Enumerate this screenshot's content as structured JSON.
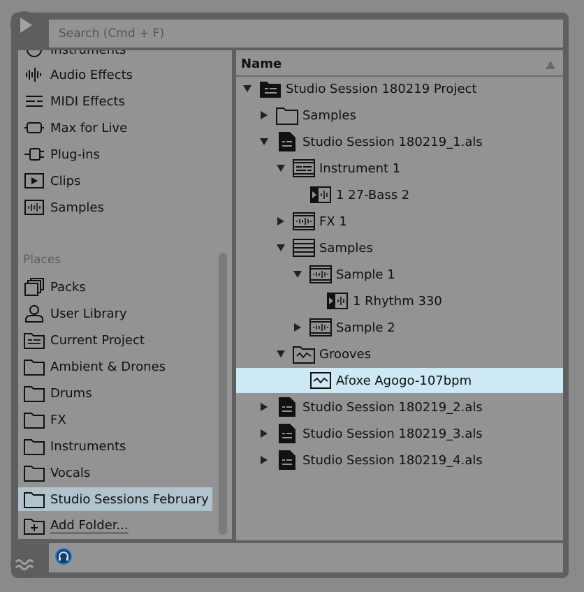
{
  "search": {
    "placeholder": "Search (Cmd + F)"
  },
  "sidebar": {
    "categories": [
      {
        "label": "Instruments",
        "icon": "instruments-icon"
      },
      {
        "label": "Audio Effects",
        "icon": "audio-effects-icon"
      },
      {
        "label": "MIDI Effects",
        "icon": "midi-effects-icon"
      },
      {
        "label": "Max for Live",
        "icon": "max-for-live-icon"
      },
      {
        "label": "Plug-ins",
        "icon": "plug-ins-icon"
      },
      {
        "label": "Clips",
        "icon": "clips-icon"
      },
      {
        "label": "Samples",
        "icon": "samples-icon"
      }
    ],
    "places_title": "Places",
    "places": [
      {
        "label": "Packs",
        "icon": "packs-icon"
      },
      {
        "label": "User Library",
        "icon": "user-icon"
      },
      {
        "label": "Current Project",
        "icon": "project-folder-icon"
      },
      {
        "label": "Ambient & Drones",
        "icon": "folder-icon"
      },
      {
        "label": "Drums",
        "icon": "folder-icon"
      },
      {
        "label": "FX",
        "icon": "folder-icon"
      },
      {
        "label": "Instruments",
        "icon": "folder-icon"
      },
      {
        "label": "Vocals",
        "icon": "folder-icon"
      },
      {
        "label": "Studio Sessions February",
        "icon": "folder-icon",
        "selected": true
      }
    ],
    "add_folder": "Add Folder..."
  },
  "tree": {
    "header": "Name",
    "rows": [
      {
        "label": "Studio Session 180219 Project",
        "expanded": true,
        "icon": "project-folder-icon"
      },
      {
        "label": "Samples",
        "expanded": false,
        "icon": "folder-icon"
      },
      {
        "label": "Studio Session 180219_1.als",
        "expanded": true,
        "icon": "live-set-icon"
      },
      {
        "label": "Instrument 1",
        "expanded": true,
        "icon": "instrument-track-icon"
      },
      {
        "label": "1 27-Bass 2",
        "icon": "audio-clip-icon"
      },
      {
        "label": "FX 1",
        "expanded": false,
        "icon": "audio-track-icon"
      },
      {
        "label": "Samples",
        "expanded": true,
        "icon": "group-track-icon"
      },
      {
        "label": "Sample 1",
        "expanded": true,
        "icon": "audio-track-icon"
      },
      {
        "label": "1 Rhythm 330",
        "icon": "audio-clip-icon"
      },
      {
        "label": "Sample 2",
        "expanded": false,
        "icon": "audio-track-icon"
      },
      {
        "label": "Grooves",
        "expanded": true,
        "icon": "groove-folder-icon"
      },
      {
        "label": "Afoxe Agogo-107bpm",
        "icon": "groove-icon",
        "selected": true
      },
      {
        "label": "Studio Session 180219_2.als",
        "expanded": false,
        "icon": "live-set-icon"
      },
      {
        "label": "Studio Session 180219_3.als",
        "expanded": false,
        "icon": "live-set-icon"
      },
      {
        "label": "Studio Session 180219_4.als",
        "expanded": false,
        "icon": "live-set-icon"
      }
    ]
  },
  "colors": {
    "panel": "#939393",
    "frame": "#5f5f5f",
    "sidebar_selected": "#b1c4cd",
    "tree_selected": "#cde9f6",
    "preview_accent": "#1e7fd6"
  }
}
